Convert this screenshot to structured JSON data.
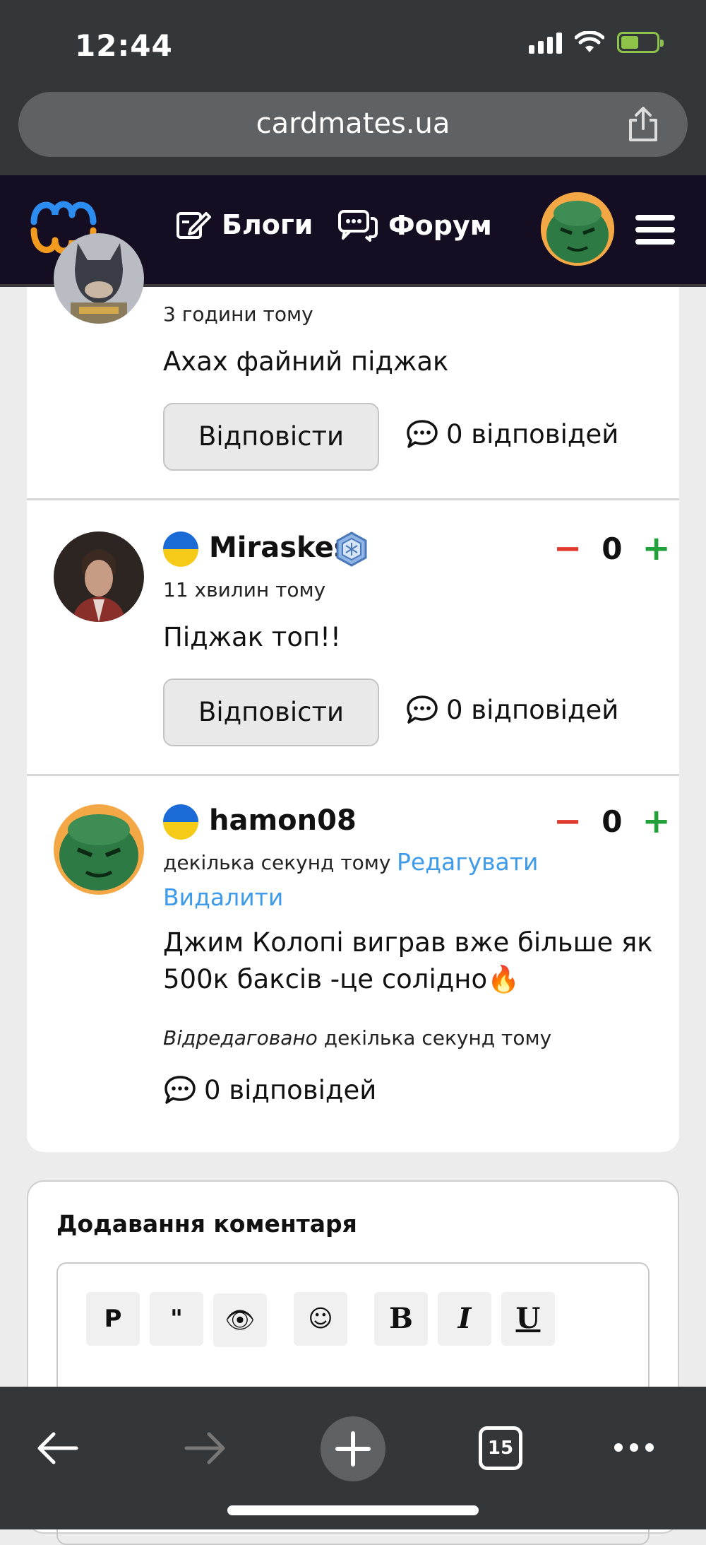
{
  "status_bar": {
    "time": "12:44"
  },
  "browser": {
    "url": "cardmates.ua",
    "tab_count": "15"
  },
  "header": {
    "nav_blogs": "Блоги",
    "nav_forum": "Форум"
  },
  "comments": [
    {
      "timestamp": "3 години тому",
      "text": "Ахах файний піджак",
      "reply_label": "Відповісти",
      "replies": "0 відповідей"
    },
    {
      "author": "Miraskes",
      "timestamp": "11 хвилин тому",
      "text": "Піджак топ!!",
      "reply_label": "Відповісти",
      "replies": "0 відповідей",
      "votes": "0",
      "minus": "−",
      "plus": "+"
    },
    {
      "author": "hamon08",
      "timestamp": "декілька секунд тому",
      "edit_label": "Редагувати",
      "delete_label": "Видалити",
      "text": "Джим Колопі виграв вже більше як 500к баксів -це солідно🔥",
      "edited_prefix": "Відредаговано",
      "edited_time": "декілька секунд тому",
      "replies": "0 відповідей",
      "votes": "0",
      "minus": "−",
      "plus": "+"
    }
  ],
  "add_comment": {
    "title": "Додавання коментаря",
    "toolbar": [
      "P",
      "\"",
      "👁",
      "☺",
      "B",
      "I",
      "U"
    ]
  },
  "colors": {
    "header_bg": "#150d22",
    "link": "#3d9be9",
    "minus": "#e03a2f",
    "plus": "#22a03a"
  }
}
